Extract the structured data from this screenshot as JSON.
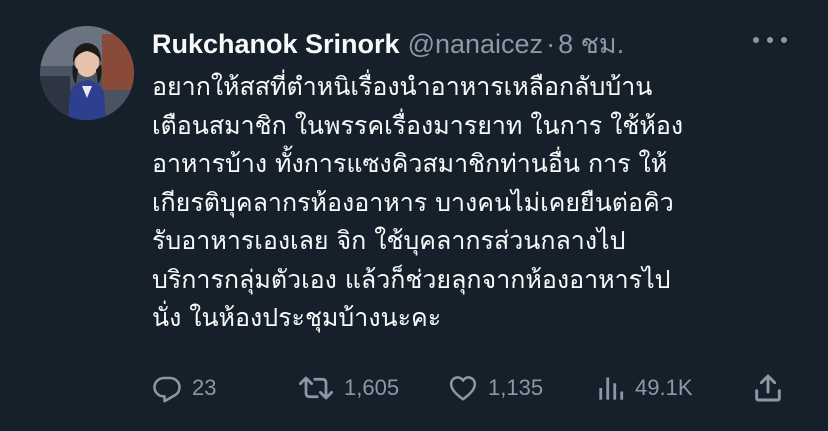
{
  "tweet": {
    "author": {
      "display_name": "Rukchanok Srinork",
      "handle": "@nanaicez",
      "separator": "·",
      "time": "8 ชม."
    },
    "more_icon": "more-horizontal-icon",
    "text_lines": [
      "อยากให้สสที่ตำหนิเรื่องนำอาหารเหลือกลับบ้าน",
      "เตือนสมาชิก ในพรรคเรื่องมารยาท ในการ ใช้ห้อง",
      "อาหารบ้าง ทั้งการแซงคิวสมาชิกท่านอื่น การ ให้",
      "เกียรติบุคลากรห้องอาหาร บางคนไม่เคยยืนต่อคิว",
      "รับอาหารเองเลย จิก ใช้บุคลากรส่วนกลางไป",
      "บริการกลุ่มตัวเอง แล้วก็ช่วยลุกจากห้องอาหารไป",
      "นั่ง ในห้องประชุมบ้างนะคะ"
    ],
    "actions": {
      "reply": {
        "icon": "reply-icon",
        "count": "23"
      },
      "retweet": {
        "icon": "retweet-icon",
        "count": "1,605"
      },
      "like": {
        "icon": "heart-icon",
        "count": "1,135"
      },
      "views": {
        "icon": "views-icon",
        "count": "49.1K"
      },
      "share": {
        "icon": "share-icon"
      }
    }
  },
  "colors": {
    "background": "#15202b",
    "primary_text": "#f7f9f9",
    "secondary_text": "#8b98a5"
  }
}
